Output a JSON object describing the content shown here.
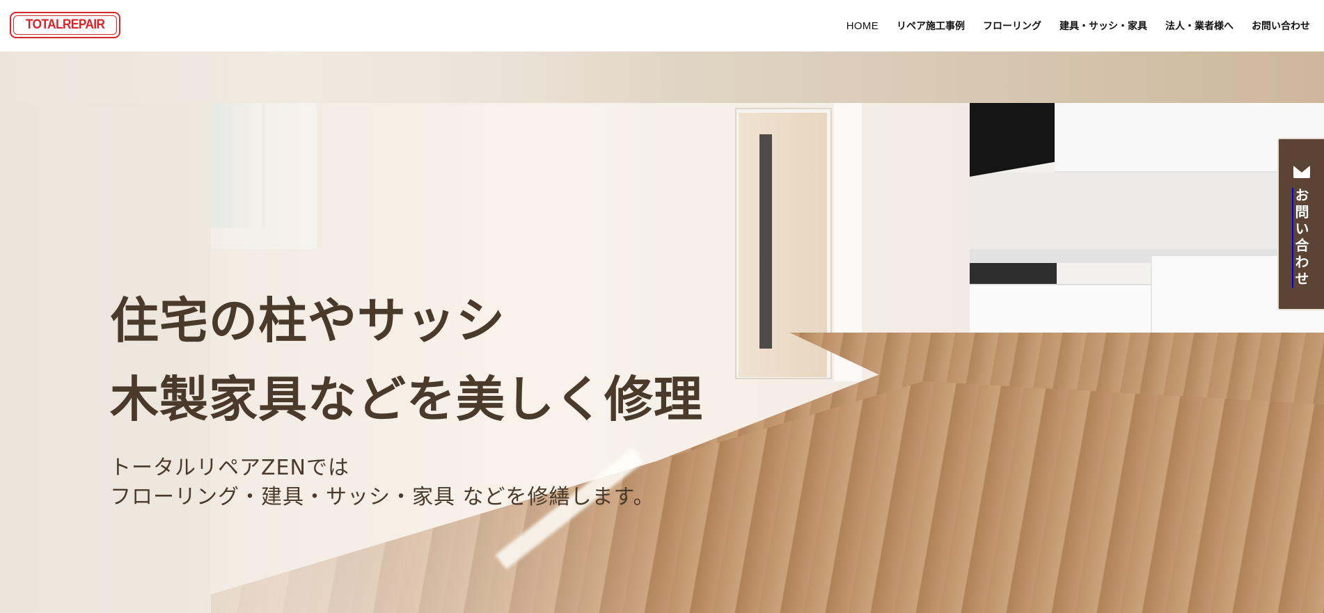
{
  "brand": {
    "logo_text": "TOTALREPAIR"
  },
  "nav": {
    "items": [
      {
        "label": "HOME"
      },
      {
        "label": "リペア施工事例"
      },
      {
        "label": "フローリング"
      },
      {
        "label": "建具・サッシ・家具"
      },
      {
        "label": "法人・業者様へ"
      },
      {
        "label": "お問い合わせ"
      }
    ]
  },
  "hero": {
    "headline_line1": "住宅の柱やサッシ",
    "headline_line2": "木製家具などを美しく修理",
    "sub_line1": "トータルリペアZENでは",
    "sub_line2": "フローリング・建具・サッシ・家具 などを修繕します。"
  },
  "side_tab": {
    "label": "お問い合わせ",
    "icon": "envelope-icon"
  },
  "colors": {
    "brand_red": "#d9242a",
    "accent_brown": "#5b4433",
    "headline_brown": "#4a3a2b"
  }
}
